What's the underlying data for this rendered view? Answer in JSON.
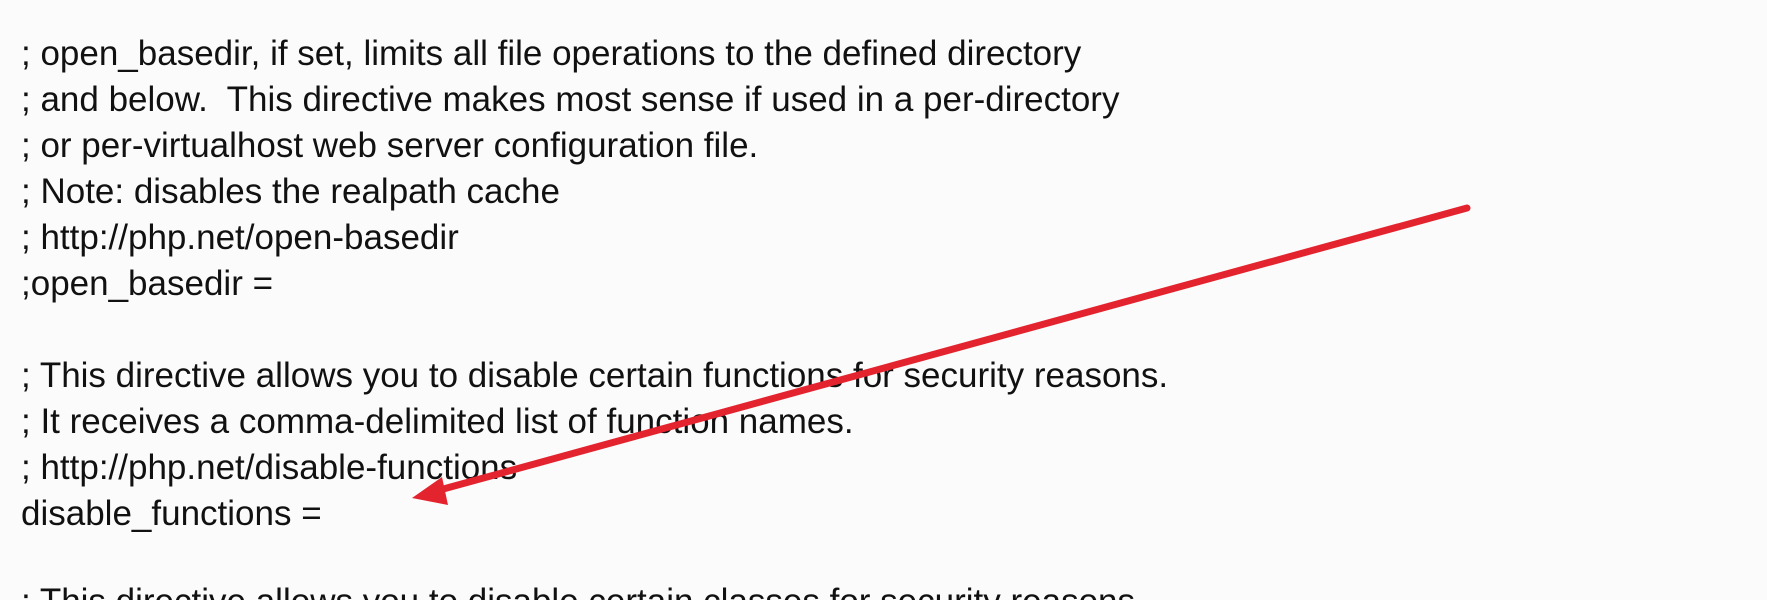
{
  "document": {
    "lines": [
      "; open_basedir, if set, limits all file operations to the defined directory",
      "; and below.  This directive makes most sense if used in a per-directory",
      "; or per-virtualhost web server configuration file.",
      "; Note: disables the realpath cache",
      "; http://php.net/open-basedir",
      ";open_basedir =",
      "",
      "; This directive allows you to disable certain functions for security reasons.",
      "; It receives a comma-delimited list of function names.",
      "; http://php.net/disable-functions",
      "disable_functions =",
      ""
    ],
    "partial_last_line": "; This directive allows you to disable certain classes for security reasons."
  },
  "annotation": {
    "type": "arrow",
    "color": "#e3242f"
  }
}
